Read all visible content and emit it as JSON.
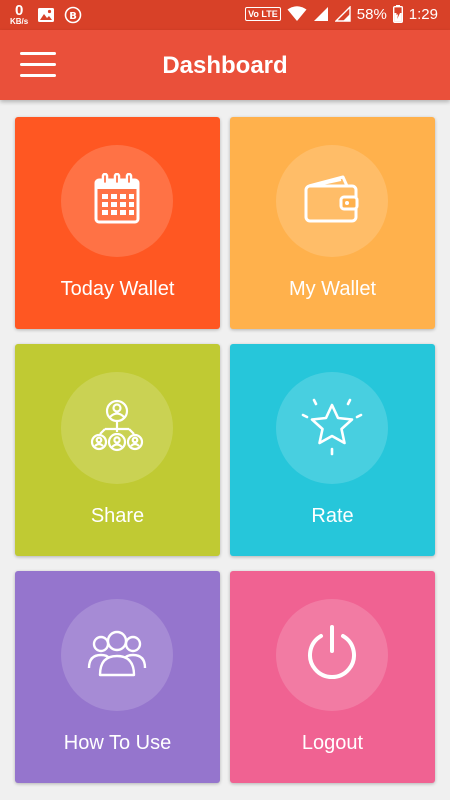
{
  "status_bar": {
    "net_speed": "0",
    "net_unit": "KB/s",
    "volte": "Vo LTE",
    "battery": "58%",
    "time": "1:29"
  },
  "app_bar": {
    "title": "Dashboard"
  },
  "tiles": [
    {
      "label": "Today Wallet",
      "icon": "calendar-icon",
      "color": "#ff5722"
    },
    {
      "label": "My Wallet",
      "icon": "wallet-icon",
      "color": "#ffb14c"
    },
    {
      "label": "Share",
      "icon": "share-people-icon",
      "color": "#c0ca33"
    },
    {
      "label": "Rate",
      "icon": "star-icon",
      "color": "#26c6da"
    },
    {
      "label": "How To Use",
      "icon": "group-users-icon",
      "color": "#9575cd"
    },
    {
      "label": "Logout",
      "icon": "power-icon",
      "color": "#f06292"
    }
  ],
  "colors": {
    "status_bar": "#d84128",
    "app_bar": "#ea503a",
    "background": "#f0f0f0"
  }
}
